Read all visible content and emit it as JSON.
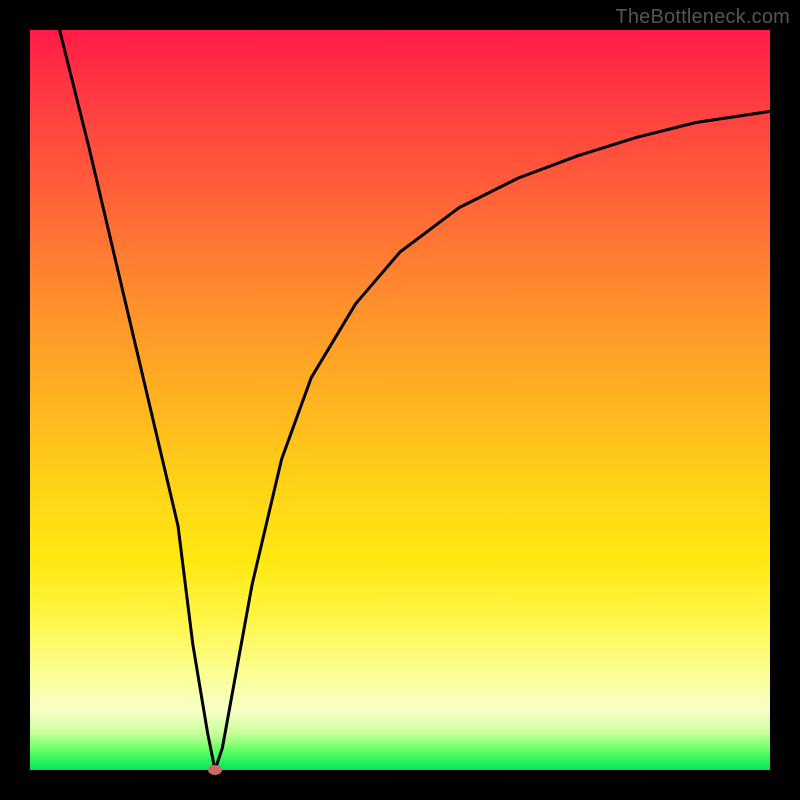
{
  "watermark": "TheBottleneck.com",
  "chart_data": {
    "type": "line",
    "title": "",
    "xlabel": "",
    "ylabel": "",
    "xlim": [
      0,
      100
    ],
    "ylim": [
      0,
      100
    ],
    "grid": false,
    "series": [
      {
        "name": "bottleneck-curve",
        "x": [
          4,
          8,
          12,
          16,
          20,
          22,
          24,
          25,
          26,
          28,
          30,
          34,
          38,
          44,
          50,
          58,
          66,
          74,
          82,
          90,
          100
        ],
        "y": [
          100,
          84,
          67,
          50,
          33,
          17,
          5,
          0,
          3,
          14,
          25,
          42,
          53,
          63,
          70,
          76,
          80,
          83,
          85.5,
          87.5,
          89
        ]
      }
    ],
    "annotations": [
      {
        "name": "minimum-marker",
        "x": 25,
        "y": 0
      }
    ],
    "background_gradient": {
      "top": "#ff1b47",
      "upper_mid": "#ffb321",
      "lower_mid": "#fff64b",
      "bottom": "#00e45e"
    }
  }
}
